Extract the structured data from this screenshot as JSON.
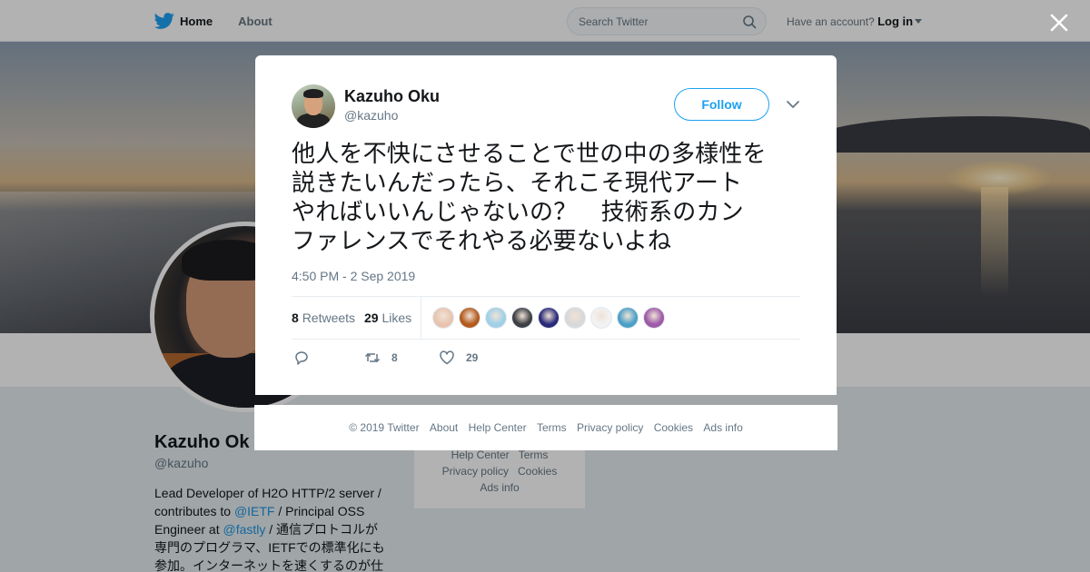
{
  "nav": {
    "home_label": "Home",
    "about_label": "About",
    "search_placeholder": "Search Twitter",
    "account_prompt": "Have an account?",
    "login_label": "Log in"
  },
  "profile": {
    "name": "Kazuho Ok",
    "handle": "@kazuho",
    "bio_lines": [
      {
        "text1": "Lead Developer of H2O HTTP/2 server /",
        "link": "",
        "text2": ""
      },
      {
        "text1": "contributes to ",
        "link": "@IETF",
        "text2": " / Principal OSS"
      },
      {
        "text1": "Engineer at ",
        "link": "@fastly",
        "text2": " / 通信プロトコルが"
      },
      {
        "text1": "専門のプログラマ、IETFでの標準化にも",
        "link": "",
        "text2": ""
      },
      {
        "text1": "参加。インターネットを速くするのが仕",
        "link": "",
        "text2": ""
      }
    ]
  },
  "side_card": {
    "items": [
      "Help Center",
      "Terms",
      "Privacy policy",
      "Cookies",
      "Ads info"
    ]
  },
  "tweet": {
    "author_name": "Kazuho Oku",
    "author_handle": "@kazuho",
    "follow_label": "Follow",
    "text_lines": [
      "他人を不快にさせることで世の中の多様性を",
      "説きたいんだったら、それこそ現代アート",
      "やればいいんじゃないの？　技術系のカン",
      "ファレンスでそれやる必要ないよね"
    ],
    "timestamp": "4:50 PM - 2 Sep 2019",
    "retweets_count": "8",
    "retweets_label": "Retweets",
    "likes_count": "29",
    "likes_label": "Likes",
    "action_retweet_count": "8",
    "action_like_count": "29",
    "liker_colors": [
      "#e8c4b0",
      "#b45a1c",
      "#9fd0e8",
      "#3c3f44",
      "#2a2a7a",
      "#d8d8d8",
      "#f2f2f2",
      "#4aa0c8",
      "#9c5aa8"
    ]
  },
  "footer": {
    "items": [
      "© 2019 Twitter",
      "About",
      "Help Center",
      "Terms",
      "Privacy policy",
      "Cookies",
      "Ads info"
    ]
  },
  "colors": {
    "brand": "#1da1f2",
    "link": "#1b95e0",
    "muted": "#657786"
  }
}
